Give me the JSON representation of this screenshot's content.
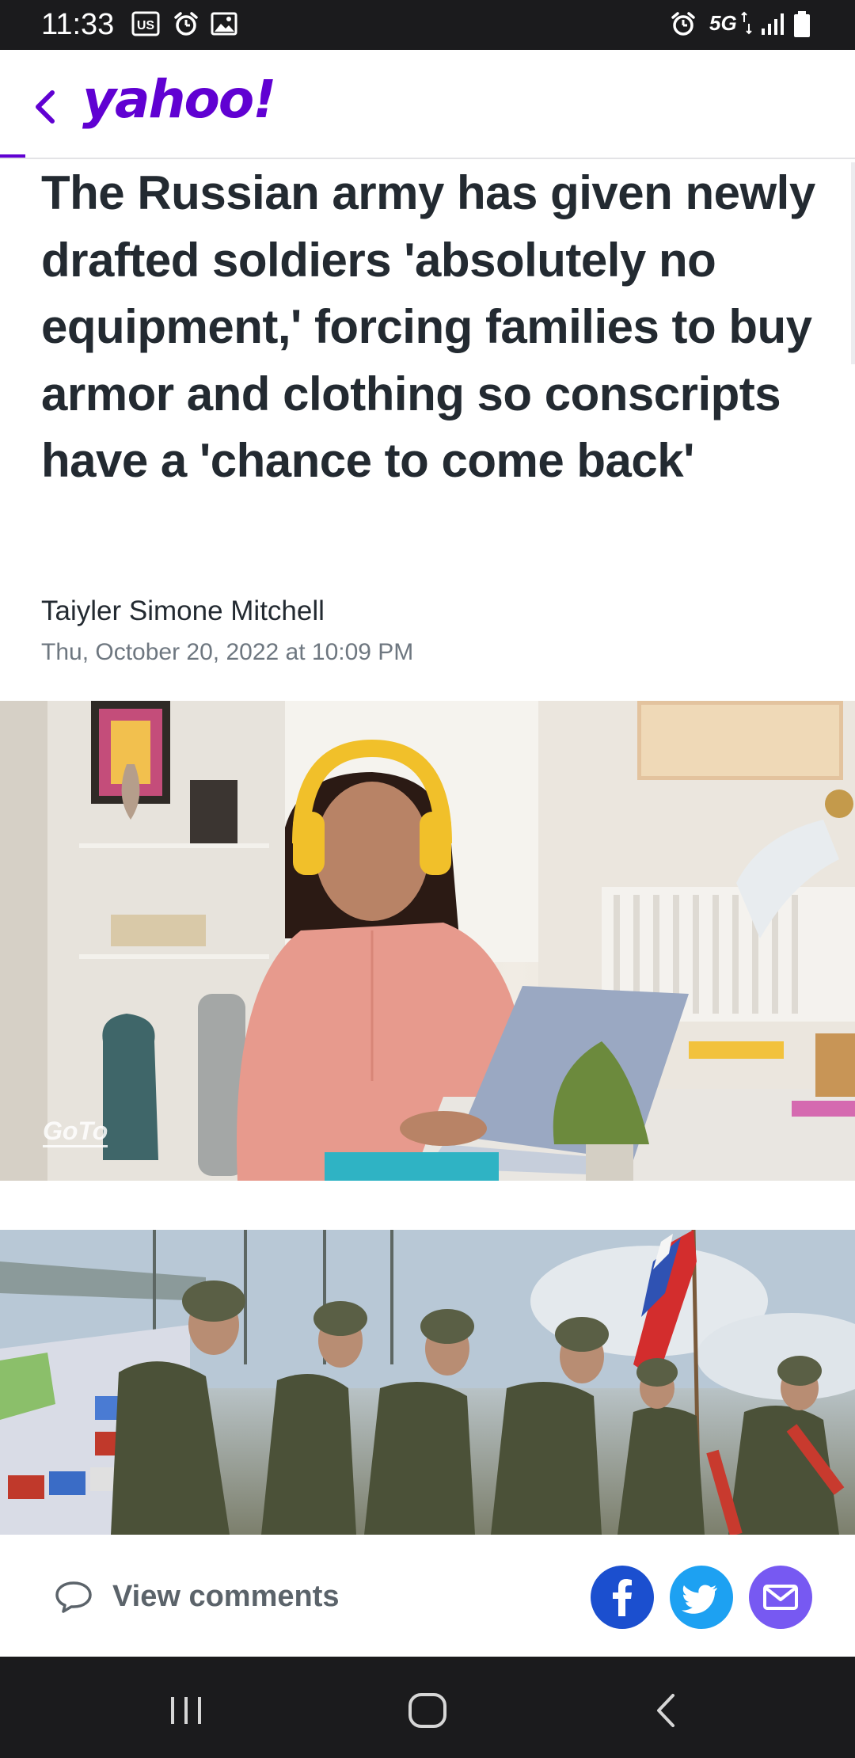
{
  "status_bar": {
    "time": "11:33",
    "network": "5G",
    "icons": [
      "us-flag-icon",
      "alarm-icon",
      "gallery-icon",
      "alarm-icon",
      "signal-icon",
      "battery-icon"
    ]
  },
  "header": {
    "logo": "yahoo!",
    "back_icon": "chevron-left-icon",
    "brand_color": "#6001d2"
  },
  "article": {
    "headline": "The Russian army has given newly drafted soldiers 'absolutely no equipment,' forcing families to buy armor and clothing so conscripts have a 'chance to come back'",
    "author": "Taiyler Simone Mitchell",
    "date": "Thu, October 20, 2022 at 10:09 PM"
  },
  "ad": {
    "brand": "GoTo"
  },
  "footer": {
    "comments_label": "View comments",
    "share": [
      {
        "name": "facebook",
        "color": "#1877f2"
      },
      {
        "name": "twitter",
        "color": "#1da1f2"
      },
      {
        "name": "email",
        "color": "#7759f2"
      }
    ]
  },
  "nav_bar": {
    "buttons": [
      "recents-icon",
      "home-icon",
      "back-icon"
    ]
  }
}
